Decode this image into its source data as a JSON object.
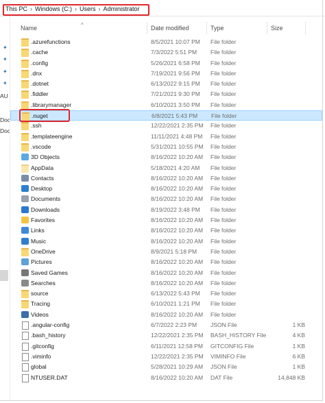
{
  "breadcrumb": [
    "This PC",
    "Windows (C:)",
    "Users",
    "Administrator"
  ],
  "nav_pane": {
    "texts": [
      "AU",
      "Doc",
      "Doc"
    ]
  },
  "columns": {
    "name": "Name",
    "date": "Date modified",
    "type": "Type",
    "size": "Size"
  },
  "files": [
    {
      "name": ".azurefunctions",
      "date": "8/5/2021 10:07 PM",
      "type": "File folder",
      "size": "",
      "icon": "folder-icon"
    },
    {
      "name": ".cache",
      "date": "7/3/2022 5:51 PM",
      "type": "File folder",
      "size": "",
      "icon": "folder-icon"
    },
    {
      "name": ".config",
      "date": "5/26/2021 6:58 PM",
      "type": "File folder",
      "size": "",
      "icon": "folder-icon"
    },
    {
      "name": ".dnx",
      "date": "7/19/2021 9:56 PM",
      "type": "File folder",
      "size": "",
      "icon": "folder-icon"
    },
    {
      "name": ".dotnet",
      "date": "6/13/2022 9:15 PM",
      "type": "File folder",
      "size": "",
      "icon": "folder-icon"
    },
    {
      "name": ".fiddler",
      "date": "7/21/2021 9:30 PM",
      "type": "File folder",
      "size": "",
      "icon": "folder-icon"
    },
    {
      "name": ".librarymanager",
      "date": "6/10/2021 3:50 PM",
      "type": "File folder",
      "size": "",
      "icon": "folder-icon"
    },
    {
      "name": ".nuget",
      "date": "6/8/2021 5:43 PM",
      "type": "File folder",
      "size": "",
      "icon": "folder-icon",
      "selected": true
    },
    {
      "name": ".ssh",
      "date": "12/22/2021 2:35 PM",
      "type": "File folder",
      "size": "",
      "icon": "folder-icon"
    },
    {
      "name": ".templateengine",
      "date": "11/11/2021 4:48 PM",
      "type": "File folder",
      "size": "",
      "icon": "folder-icon"
    },
    {
      "name": ".vscode",
      "date": "5/31/2021 10:55 PM",
      "type": "File folder",
      "size": "",
      "icon": "folder-icon"
    },
    {
      "name": "3D Objects",
      "date": "8/16/2022 10:20 AM",
      "type": "File folder",
      "size": "",
      "icon": "3d-objects-icon"
    },
    {
      "name": "AppData",
      "date": "5/18/2021 4:20 AM",
      "type": "File folder",
      "size": "",
      "icon": "folder-icon-light"
    },
    {
      "name": "Contacts",
      "date": "8/16/2022 10:20 AM",
      "type": "File folder",
      "size": "",
      "icon": "contacts-icon"
    },
    {
      "name": "Desktop",
      "date": "8/16/2022 10:20 AM",
      "type": "File folder",
      "size": "",
      "icon": "desktop-icon"
    },
    {
      "name": "Documents",
      "date": "8/16/2022 10:20 AM",
      "type": "File folder",
      "size": "",
      "icon": "documents-icon"
    },
    {
      "name": "Downloads",
      "date": "8/19/2022 3:48 PM",
      "type": "File folder",
      "size": "",
      "icon": "downloads-icon"
    },
    {
      "name": "Favorites",
      "date": "8/16/2022 10:20 AM",
      "type": "File folder",
      "size": "",
      "icon": "favorites-icon"
    },
    {
      "name": "Links",
      "date": "8/16/2022 10:20 AM",
      "type": "File folder",
      "size": "",
      "icon": "links-icon"
    },
    {
      "name": "Music",
      "date": "8/16/2022 10:20 AM",
      "type": "File folder",
      "size": "",
      "icon": "music-icon"
    },
    {
      "name": "OneDrive",
      "date": "8/9/2021 5:18 PM",
      "type": "File folder",
      "size": "",
      "icon": "folder-icon"
    },
    {
      "name": "Pictures",
      "date": "8/16/2022 10:20 AM",
      "type": "File folder",
      "size": "",
      "icon": "pictures-icon"
    },
    {
      "name": "Saved Games",
      "date": "8/16/2022 10:20 AM",
      "type": "File folder",
      "size": "",
      "icon": "saved-games-icon"
    },
    {
      "name": "Searches",
      "date": "8/16/2022 10:20 AM",
      "type": "File folder",
      "size": "",
      "icon": "searches-icon"
    },
    {
      "name": "source",
      "date": "6/13/2022 5:43 PM",
      "type": "File folder",
      "size": "",
      "icon": "folder-icon"
    },
    {
      "name": "Tracing",
      "date": "6/10/2021 1:21 PM",
      "type": "File folder",
      "size": "",
      "icon": "folder-icon"
    },
    {
      "name": "Videos",
      "date": "8/16/2022 10:20 AM",
      "type": "File folder",
      "size": "",
      "icon": "videos-icon"
    },
    {
      "name": ".angular-config",
      "date": "6/7/2022 2:23 PM",
      "type": "JSON File",
      "size": "1 KB",
      "icon": "file-icon"
    },
    {
      "name": ".bash_history",
      "date": "12/22/2021 2:35 PM",
      "type": "BASH_HISTORY File",
      "size": "4 KB",
      "icon": "file-icon"
    },
    {
      "name": ".gitconfig",
      "date": "6/11/2021 12:58 PM",
      "type": "GITCONFIG File",
      "size": "1 KB",
      "icon": "file-icon"
    },
    {
      "name": ".viminfo",
      "date": "12/22/2021 2:35 PM",
      "type": "VIMINFO File",
      "size": "6 KB",
      "icon": "file-icon"
    },
    {
      "name": "global",
      "date": "5/28/2021 10:29 AM",
      "type": "JSON File",
      "size": "1 KB",
      "icon": "json-icon"
    },
    {
      "name": "NTUSER.DAT",
      "date": "8/16/2022 10:20 AM",
      "type": "DAT File",
      "size": "14,848 KB",
      "icon": "file-icon"
    }
  ],
  "colors": {
    "highlight": "#e0272b",
    "selection": "#cce8ff",
    "folder": "#f8d775"
  }
}
